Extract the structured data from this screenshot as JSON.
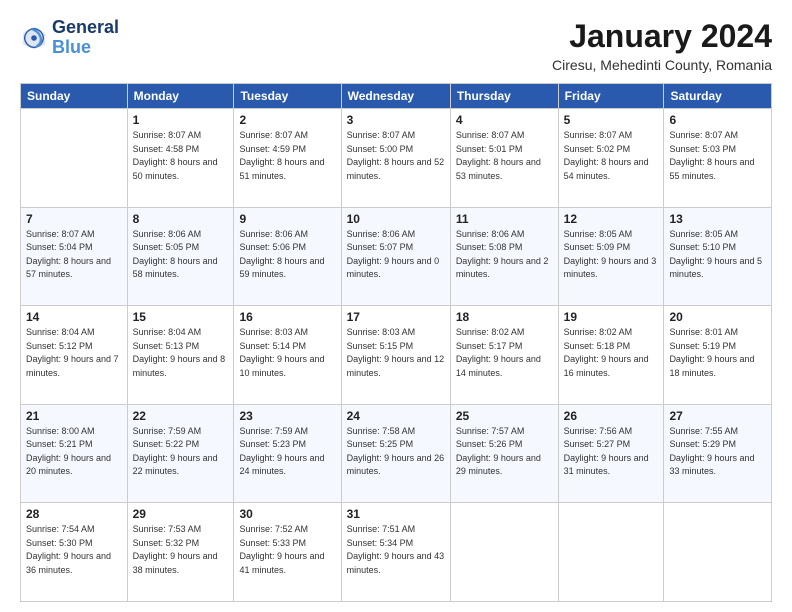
{
  "header": {
    "logo_line1": "General",
    "logo_line2": "Blue",
    "month": "January 2024",
    "location": "Ciresu, Mehedinti County, Romania"
  },
  "weekdays": [
    "Sunday",
    "Monday",
    "Tuesday",
    "Wednesday",
    "Thursday",
    "Friday",
    "Saturday"
  ],
  "weeks": [
    [
      {
        "day": "",
        "sunrise": "",
        "sunset": "",
        "daylight": ""
      },
      {
        "day": "1",
        "sunrise": "Sunrise: 8:07 AM",
        "sunset": "Sunset: 4:58 PM",
        "daylight": "Daylight: 8 hours and 50 minutes."
      },
      {
        "day": "2",
        "sunrise": "Sunrise: 8:07 AM",
        "sunset": "Sunset: 4:59 PM",
        "daylight": "Daylight: 8 hours and 51 minutes."
      },
      {
        "day": "3",
        "sunrise": "Sunrise: 8:07 AM",
        "sunset": "Sunset: 5:00 PM",
        "daylight": "Daylight: 8 hours and 52 minutes."
      },
      {
        "day": "4",
        "sunrise": "Sunrise: 8:07 AM",
        "sunset": "Sunset: 5:01 PM",
        "daylight": "Daylight: 8 hours and 53 minutes."
      },
      {
        "day": "5",
        "sunrise": "Sunrise: 8:07 AM",
        "sunset": "Sunset: 5:02 PM",
        "daylight": "Daylight: 8 hours and 54 minutes."
      },
      {
        "day": "6",
        "sunrise": "Sunrise: 8:07 AM",
        "sunset": "Sunset: 5:03 PM",
        "daylight": "Daylight: 8 hours and 55 minutes."
      }
    ],
    [
      {
        "day": "7",
        "sunrise": "Sunrise: 8:07 AM",
        "sunset": "Sunset: 5:04 PM",
        "daylight": "Daylight: 8 hours and 57 minutes."
      },
      {
        "day": "8",
        "sunrise": "Sunrise: 8:06 AM",
        "sunset": "Sunset: 5:05 PM",
        "daylight": "Daylight: 8 hours and 58 minutes."
      },
      {
        "day": "9",
        "sunrise": "Sunrise: 8:06 AM",
        "sunset": "Sunset: 5:06 PM",
        "daylight": "Daylight: 8 hours and 59 minutes."
      },
      {
        "day": "10",
        "sunrise": "Sunrise: 8:06 AM",
        "sunset": "Sunset: 5:07 PM",
        "daylight": "Daylight: 9 hours and 0 minutes."
      },
      {
        "day": "11",
        "sunrise": "Sunrise: 8:06 AM",
        "sunset": "Sunset: 5:08 PM",
        "daylight": "Daylight: 9 hours and 2 minutes."
      },
      {
        "day": "12",
        "sunrise": "Sunrise: 8:05 AM",
        "sunset": "Sunset: 5:09 PM",
        "daylight": "Daylight: 9 hours and 3 minutes."
      },
      {
        "day": "13",
        "sunrise": "Sunrise: 8:05 AM",
        "sunset": "Sunset: 5:10 PM",
        "daylight": "Daylight: 9 hours and 5 minutes."
      }
    ],
    [
      {
        "day": "14",
        "sunrise": "Sunrise: 8:04 AM",
        "sunset": "Sunset: 5:12 PM",
        "daylight": "Daylight: 9 hours and 7 minutes."
      },
      {
        "day": "15",
        "sunrise": "Sunrise: 8:04 AM",
        "sunset": "Sunset: 5:13 PM",
        "daylight": "Daylight: 9 hours and 8 minutes."
      },
      {
        "day": "16",
        "sunrise": "Sunrise: 8:03 AM",
        "sunset": "Sunset: 5:14 PM",
        "daylight": "Daylight: 9 hours and 10 minutes."
      },
      {
        "day": "17",
        "sunrise": "Sunrise: 8:03 AM",
        "sunset": "Sunset: 5:15 PM",
        "daylight": "Daylight: 9 hours and 12 minutes."
      },
      {
        "day": "18",
        "sunrise": "Sunrise: 8:02 AM",
        "sunset": "Sunset: 5:17 PM",
        "daylight": "Daylight: 9 hours and 14 minutes."
      },
      {
        "day": "19",
        "sunrise": "Sunrise: 8:02 AM",
        "sunset": "Sunset: 5:18 PM",
        "daylight": "Daylight: 9 hours and 16 minutes."
      },
      {
        "day": "20",
        "sunrise": "Sunrise: 8:01 AM",
        "sunset": "Sunset: 5:19 PM",
        "daylight": "Daylight: 9 hours and 18 minutes."
      }
    ],
    [
      {
        "day": "21",
        "sunrise": "Sunrise: 8:00 AM",
        "sunset": "Sunset: 5:21 PM",
        "daylight": "Daylight: 9 hours and 20 minutes."
      },
      {
        "day": "22",
        "sunrise": "Sunrise: 7:59 AM",
        "sunset": "Sunset: 5:22 PM",
        "daylight": "Daylight: 9 hours and 22 minutes."
      },
      {
        "day": "23",
        "sunrise": "Sunrise: 7:59 AM",
        "sunset": "Sunset: 5:23 PM",
        "daylight": "Daylight: 9 hours and 24 minutes."
      },
      {
        "day": "24",
        "sunrise": "Sunrise: 7:58 AM",
        "sunset": "Sunset: 5:25 PM",
        "daylight": "Daylight: 9 hours and 26 minutes."
      },
      {
        "day": "25",
        "sunrise": "Sunrise: 7:57 AM",
        "sunset": "Sunset: 5:26 PM",
        "daylight": "Daylight: 9 hours and 29 minutes."
      },
      {
        "day": "26",
        "sunrise": "Sunrise: 7:56 AM",
        "sunset": "Sunset: 5:27 PM",
        "daylight": "Daylight: 9 hours and 31 minutes."
      },
      {
        "day": "27",
        "sunrise": "Sunrise: 7:55 AM",
        "sunset": "Sunset: 5:29 PM",
        "daylight": "Daylight: 9 hours and 33 minutes."
      }
    ],
    [
      {
        "day": "28",
        "sunrise": "Sunrise: 7:54 AM",
        "sunset": "Sunset: 5:30 PM",
        "daylight": "Daylight: 9 hours and 36 minutes."
      },
      {
        "day": "29",
        "sunrise": "Sunrise: 7:53 AM",
        "sunset": "Sunset: 5:32 PM",
        "daylight": "Daylight: 9 hours and 38 minutes."
      },
      {
        "day": "30",
        "sunrise": "Sunrise: 7:52 AM",
        "sunset": "Sunset: 5:33 PM",
        "daylight": "Daylight: 9 hours and 41 minutes."
      },
      {
        "day": "31",
        "sunrise": "Sunrise: 7:51 AM",
        "sunset": "Sunset: 5:34 PM",
        "daylight": "Daylight: 9 hours and 43 minutes."
      },
      {
        "day": "",
        "sunrise": "",
        "sunset": "",
        "daylight": ""
      },
      {
        "day": "",
        "sunrise": "",
        "sunset": "",
        "daylight": ""
      },
      {
        "day": "",
        "sunrise": "",
        "sunset": "",
        "daylight": ""
      }
    ]
  ]
}
